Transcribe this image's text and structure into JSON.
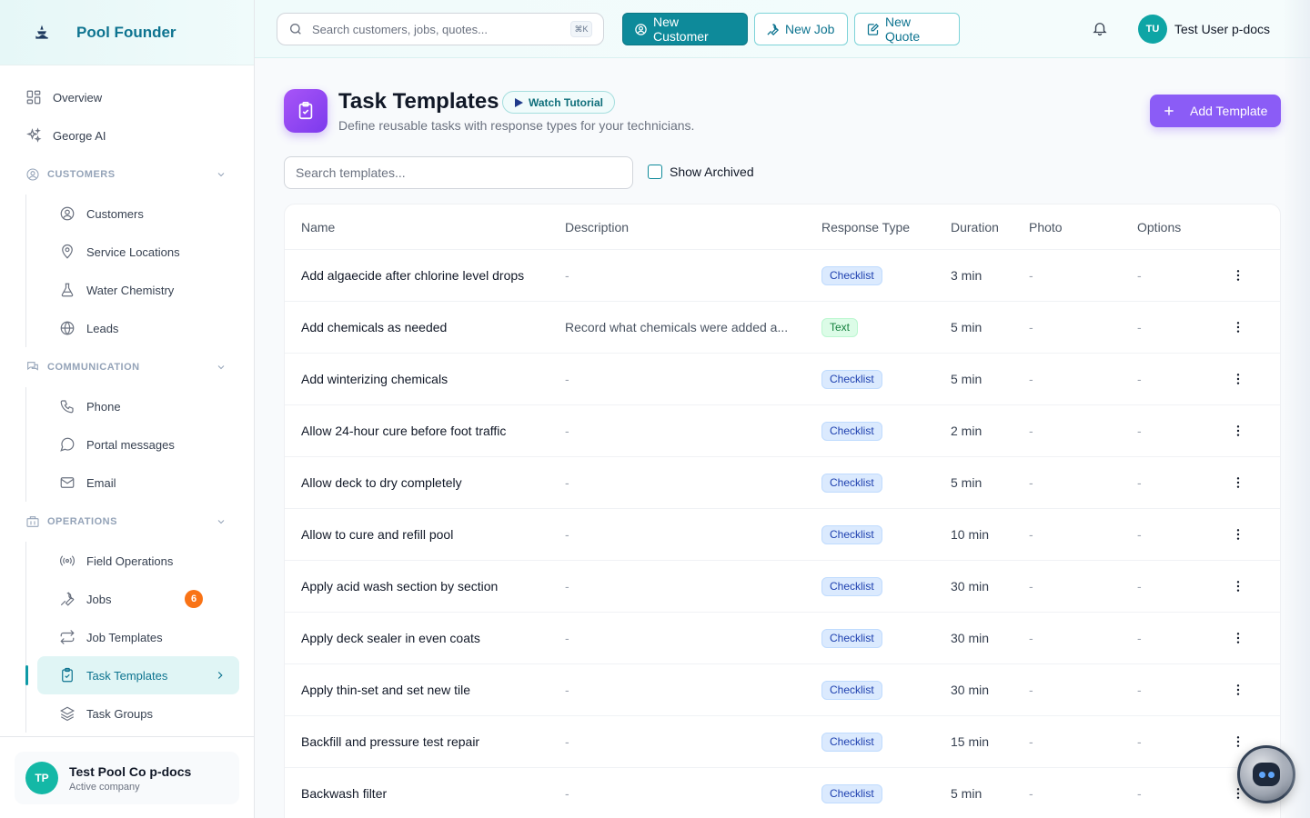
{
  "brand": {
    "name": "Pool Founder"
  },
  "sidebar": {
    "top_items": [
      {
        "label": "Overview"
      },
      {
        "label": "George AI"
      }
    ],
    "sections": {
      "customers": {
        "title": "CUSTOMERS",
        "items": [
          {
            "label": "Customers"
          },
          {
            "label": "Service Locations"
          },
          {
            "label": "Water Chemistry"
          },
          {
            "label": "Leads"
          }
        ]
      },
      "communication": {
        "title": "COMMUNICATION",
        "items": [
          {
            "label": "Phone"
          },
          {
            "label": "Portal messages"
          },
          {
            "label": "Email"
          }
        ]
      },
      "operations": {
        "title": "OPERATIONS",
        "items": [
          {
            "label": "Field Operations"
          },
          {
            "label": "Jobs",
            "badge": "6"
          },
          {
            "label": "Job Templates"
          },
          {
            "label": "Task Templates",
            "active": true
          },
          {
            "label": "Task Groups"
          }
        ]
      }
    },
    "company": {
      "initials": "TP",
      "name": "Test Pool Co p-docs",
      "status": "Active company"
    }
  },
  "topbar": {
    "search_placeholder": "Search customers, jobs, quotes...",
    "shortcut": "⌘K",
    "new_customer": "New Customer",
    "new_job": "New Job",
    "new_quote": "New Quote",
    "user_initials": "TU",
    "user_name": "Test User p-docs"
  },
  "page": {
    "title": "Task Templates",
    "tutorial_label": "Watch Tutorial",
    "subtitle": "Define reusable tasks with response types for your technicians.",
    "add_button": "Add Template",
    "search_placeholder": "Search templates...",
    "show_archived_label": "Show Archived"
  },
  "table": {
    "columns": [
      "Name",
      "Description",
      "Response Type",
      "Duration",
      "Photo",
      "Options"
    ],
    "rows": [
      {
        "name": "Add algaecide after chlorine level drops",
        "description": "-",
        "type": "Checklist",
        "duration": "3 min",
        "photo": "-",
        "options": "-"
      },
      {
        "name": "Add chemicals as needed",
        "description": "Record what chemicals were added a...",
        "type": "Text",
        "duration": "5 min",
        "photo": "-",
        "options": "-"
      },
      {
        "name": "Add winterizing chemicals",
        "description": "-",
        "type": "Checklist",
        "duration": "5 min",
        "photo": "-",
        "options": "-"
      },
      {
        "name": "Allow 24-hour cure before foot traffic",
        "description": "-",
        "type": "Checklist",
        "duration": "2 min",
        "photo": "-",
        "options": "-"
      },
      {
        "name": "Allow deck to dry completely",
        "description": "-",
        "type": "Checklist",
        "duration": "5 min",
        "photo": "-",
        "options": "-"
      },
      {
        "name": "Allow to cure and refill pool",
        "description": "-",
        "type": "Checklist",
        "duration": "10 min",
        "photo": "-",
        "options": "-"
      },
      {
        "name": "Apply acid wash section by section",
        "description": "-",
        "type": "Checklist",
        "duration": "30 min",
        "photo": "-",
        "options": "-"
      },
      {
        "name": "Apply deck sealer in even coats",
        "description": "-",
        "type": "Checklist",
        "duration": "30 min",
        "photo": "-",
        "options": "-"
      },
      {
        "name": "Apply thin-set and set new tile",
        "description": "-",
        "type": "Checklist",
        "duration": "30 min",
        "photo": "-",
        "options": "-"
      },
      {
        "name": "Backfill and pressure test repair",
        "description": "-",
        "type": "Checklist",
        "duration": "15 min",
        "photo": "-",
        "options": "-"
      },
      {
        "name": "Backwash filter",
        "description": "-",
        "type": "Checklist",
        "duration": "5 min",
        "photo": "-",
        "options": "-"
      }
    ]
  },
  "colors": {
    "brand_teal": "#0e8a9a",
    "accent_purple": "#8b5cf6",
    "badge_orange": "#f97316"
  }
}
